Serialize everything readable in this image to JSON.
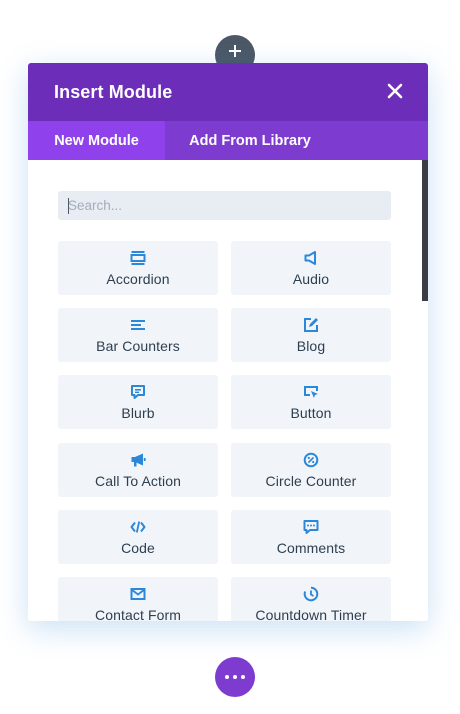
{
  "header": {
    "title": "Insert Module"
  },
  "tabs": [
    {
      "label": "New Module",
      "active": true
    },
    {
      "label": "Add From Library",
      "active": false
    }
  ],
  "search": {
    "placeholder": "Search..."
  },
  "modules": [
    {
      "label": "Accordion",
      "icon": "accordion-icon"
    },
    {
      "label": "Audio",
      "icon": "audio-icon"
    },
    {
      "label": "Bar Counters",
      "icon": "bar-counters-icon"
    },
    {
      "label": "Blog",
      "icon": "blog-icon"
    },
    {
      "label": "Blurb",
      "icon": "blurb-icon"
    },
    {
      "label": "Button",
      "icon": "button-icon"
    },
    {
      "label": "Call To Action",
      "icon": "megaphone-icon"
    },
    {
      "label": "Circle Counter",
      "icon": "circle-counter-icon"
    },
    {
      "label": "Code",
      "icon": "code-icon"
    },
    {
      "label": "Comments",
      "icon": "comments-icon"
    },
    {
      "label": "Contact Form",
      "icon": "envelope-icon"
    },
    {
      "label": "Countdown Timer",
      "icon": "clock-icon"
    }
  ],
  "colors": {
    "header": "#6c2eb9",
    "tab_bar": "#7e3bd0",
    "tab_active": "#8f42ec",
    "icon": "#2b87da",
    "tile": "#f1f5f9",
    "label": "#2d3e4f"
  }
}
